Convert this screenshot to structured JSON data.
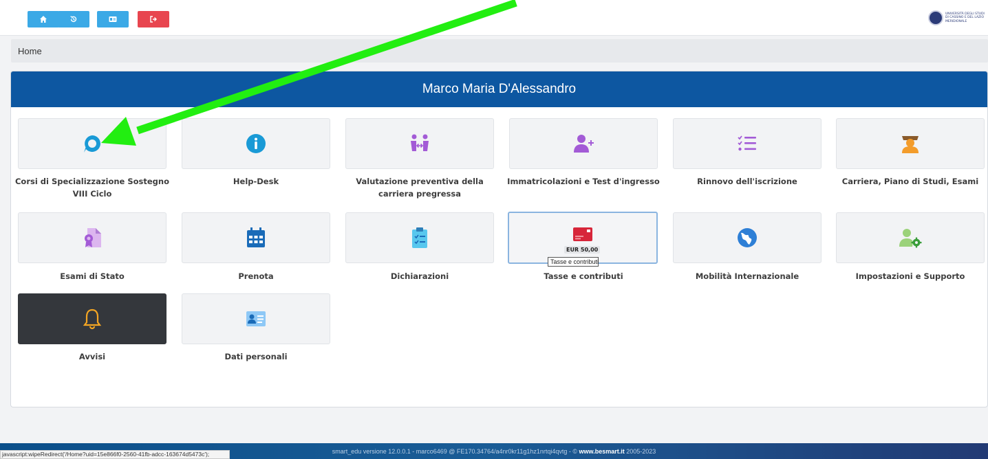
{
  "topbar": {
    "buttons": [
      {
        "icon": "home-icon",
        "color": "#3ba9e6"
      },
      {
        "icon": "history-icon",
        "color": "#3ba9e6"
      },
      {
        "icon": "id-card-icon",
        "color": "#3ba9e6"
      },
      {
        "icon": "logout-icon",
        "color": "#e8454f"
      }
    ],
    "logo_text": "UNIVERSITÀ DEGLI STUDI DI CASSINO E DEL LAZIO MERIDIONALE"
  },
  "breadcrumb": "Home",
  "panel": {
    "user_name": "Marco Maria D'Alessandro",
    "header_color": "#0d57a1"
  },
  "tiles": [
    {
      "label": "Corsi di Specializzazione Sostegno VIII Ciclo",
      "icon": "chat-bubble-icon"
    },
    {
      "label": "Help-Desk",
      "icon": "info-icon"
    },
    {
      "label": "Valutazione preventiva della carriera pregressa",
      "icon": "people-exchange-icon"
    },
    {
      "label": "Immatricolazioni e Test d'ingresso",
      "icon": "user-add-icon"
    },
    {
      "label": "Rinnovo dell'iscrizione",
      "icon": "checklist-icon"
    },
    {
      "label": "Carriera, Piano di Studi, Esami",
      "icon": "graduate-icon"
    },
    {
      "label": "Esami di Stato",
      "icon": "certificate-icon"
    },
    {
      "label": "Prenota",
      "icon": "calendar-icon"
    },
    {
      "label": "Dichiarazioni",
      "icon": "clipboard-icon"
    },
    {
      "label": "Tasse e contributi",
      "icon": "credit-card-icon",
      "badge": "EUR 50,00",
      "tooltip": "Tasse e contributi"
    },
    {
      "label": "Mobilità Internazionale",
      "icon": "globe-icon"
    },
    {
      "label": "Impostazioni e Supporto",
      "icon": "user-settings-icon"
    },
    {
      "label": "Avvisi",
      "icon": "bell-icon"
    },
    {
      "label": "Dati personali",
      "icon": "contact-card-icon"
    }
  ],
  "footer": {
    "text": "smart_edu versione 12.0.0.1 - marco6469 @ FE170.34764/a4nr0kr11g1hz1nrtqi4qvtg - ©",
    "brand": "www.besmart.it",
    "years": "2005-2023"
  },
  "status_url": "javascript:wipeRedirect('/Home?uid=15e866f0-2560-41fb-adcc-163674d5473c');",
  "annotation_color": "#22ee11"
}
